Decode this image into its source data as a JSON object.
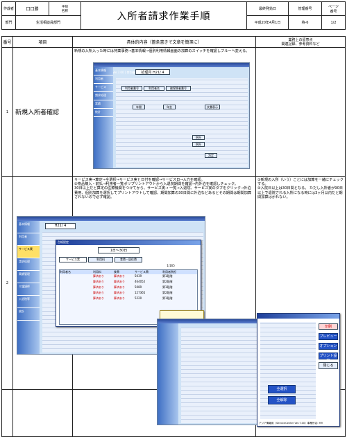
{
  "header": {
    "owner_label": "作成者",
    "owner_value": "口口勝",
    "signer_label": "手続\n名称",
    "dept_label": "部門",
    "dept_value": "生活相談員部門",
    "title": "入所者請求作業手順",
    "date_label": "最終発効日",
    "date_value": "平成20年4月1日",
    "mgmt_label": "管理番号",
    "mgmt_value": "将-6",
    "page_label": "ページ\n番号",
    "page_value": "1/2"
  },
  "columns": {
    "no": "番号",
    "item": "項目",
    "content": "具体的内容（箇条書きで文章を簡潔に）",
    "notes": "業務上の留意点\n関連記録、参考資料など"
  },
  "rows": [
    {
      "no": "1",
      "item": "新規入所者確認",
      "text": "新規の入所入った時には持薬事務→基本情報→個別利用情報画面の加算のスイッチを確認しブルーへ変える。",
      "notes": ""
    },
    {
      "no": "2",
      "item": "",
      "text": "サービス実→算定→全選択→サービス実と日付を確認→サービス日→入力を確認。\n②物品購入・前払→利用者一覧ポリプリントアウトから入退院期間を確認→内外泊を確認しチェック。\n30日以上だと算定の医療機関をつけてから、サービス実→ 一覧→入退院、サービス実のタブをクリック→外泊費用、個別加算を選択してプリントアウトして確認、期間加算の30日間に外泊などあるとその期間は期間加算されないので必ず確認。",
      "notes": "①新規の入所（いう）ことには加算を一緒にチェックする。\n②入院日以上は30日間となる。 ただし入所者が90日以上で退院される入所になる時には3ヶ月以内だと期間加算はかれない。"
    }
  ],
  "shot1": {
    "title": "介護システム Ver.7.00 [ 特別養護老人ホーム ]",
    "menu": [
      "基本情報",
      "利用者",
      "サービス",
      "請求処理",
      "実績",
      "統計"
    ],
    "month_label": "処理月",
    "month_value": "H21/ 4",
    "labels": [
      "利用者番号",
      "利用者名",
      "被保険者番号"
    ],
    "tabs": [
      "年間",
      "年金",
      "文書表示"
    ],
    "buttons": [
      "例外",
      "判定",
      "例外"
    ]
  },
  "shot2": {
    "title": "介護システム",
    "month_value": "H21/ 4",
    "menu": [
      "基本情報",
      "利用者",
      "サービス実",
      "請求処理",
      "実績管理",
      "介護講師",
      "入退院等",
      "統計"
    ]
  },
  "dialog1": {
    "title": "台帳設定",
    "range": "1日〜30日",
    "tabs": [
      "サービス実",
      "利用料",
      "食費・居住費"
    ],
    "table_headers": [
      "利用者名",
      "利用料",
      "食費",
      "サービス費",
      "利用者負担"
    ],
    "rows": [
      [
        "5039",
        "第1段階"
      ],
      [
        "464052",
        "第2段階"
      ],
      [
        "5089",
        "第1段階"
      ],
      [
        "127365",
        "第2段階"
      ],
      [
        "5220",
        "第1段階"
      ]
    ],
    "tags": [
      "算済あり",
      "算済あり",
      "算済あり",
      "算済あり",
      "算済あり"
    ],
    "count": "1/165"
  },
  "dialog3": {
    "buttons": [
      "全選択",
      "全解除"
    ],
    "right_buttons": [
      "プレビュー",
      "オプション",
      "プリント設定",
      "閉じる"
    ],
    "red_button": "印刷",
    "footer": "アジア情報用（ServiceCenter Ver.7.00）事業所名: M9"
  }
}
